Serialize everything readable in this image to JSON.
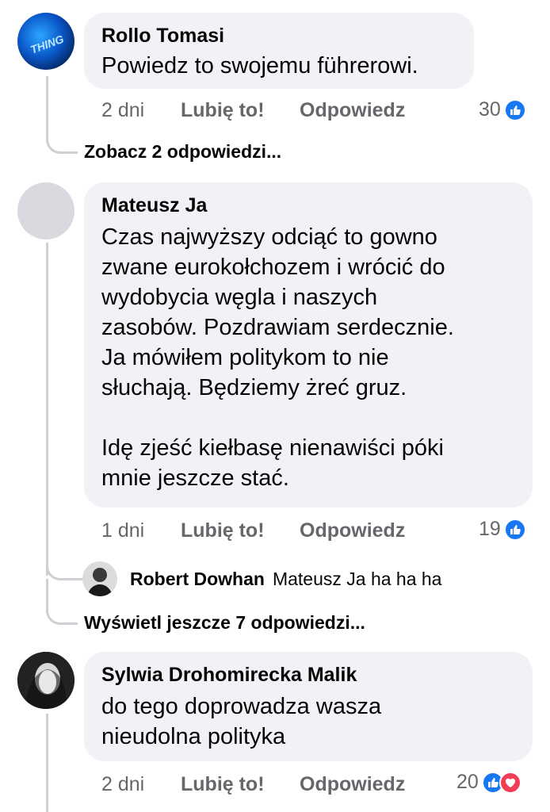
{
  "comments": [
    {
      "author": "Rollo Tomasi",
      "text": "Powiedz to swojemu führerowi.",
      "time": "2 dni",
      "like_label": "Lubię to!",
      "reply_label": "Odpowiedz",
      "reaction_count": "30",
      "reactions": [
        "like-icon"
      ],
      "more_replies": "Zobacz 2 odpowiedzi..."
    },
    {
      "author": "Mateusz Ja",
      "text": "Czas najwyższy odciąć to gowno\nzwane eurokołchozem i wrócić do\nwydobycia węgla i naszych\nzasobów. Pozdrawiam serdecznie.\nJa mówiłem politykom to nie\nsłuchają. Będziemy żreć gruz.\n\nIdę zjeść kiełbasę nienawiści póki\nmnie jeszcze stać.",
      "time": "1 dni",
      "like_label": "Lubię to!",
      "reply_label": "Odpowiedz",
      "reaction_count": "19",
      "reactions": [
        "like-icon"
      ],
      "reply_preview": {
        "author": "Robert Dowhan",
        "text": "Mateusz Ja ha ha ha"
      },
      "more_replies": "Wyświetl jeszcze 7 odpowiedzi..."
    },
    {
      "author": "Sylwia Drohomirecka Malik",
      "text": "do tego doprowadza wasza\nnieudolna polityka",
      "time": "2 dni",
      "like_label": "Lubię to!",
      "reply_label": "Odpowiedz",
      "reaction_count": "20",
      "reactions": [
        "like-icon",
        "love-icon"
      ]
    }
  ],
  "avatar_logo_text": "THING",
  "colors": {
    "bubble": "#f0f2f5",
    "meta_text": "#65676b",
    "like_blue": "#1877f2",
    "love_red": "#f33e58",
    "thread_line": "#ccd0d5"
  }
}
